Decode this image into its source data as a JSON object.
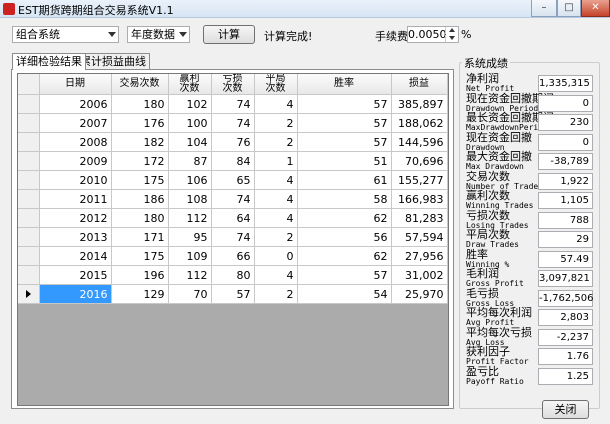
{
  "window": {
    "title": "EST期货跨期组合交易系统V1.1"
  },
  "controls": {
    "system_select": "组合系统",
    "period_select": "年度数据",
    "compute_button": "计算",
    "status": "计算完成!",
    "fee_label": "手续费",
    "fee_value": "0.0050",
    "fee_unit": "%"
  },
  "tabs": [
    {
      "label": "详细检验结果",
      "active": true
    },
    {
      "label": "累计损益曲线",
      "active": false
    }
  ],
  "table": {
    "headers": [
      "日期",
      "交易次数",
      "赢利\n次数",
      "亏损\n次数",
      "平局\n次数",
      "胜率",
      "损益"
    ],
    "rows": [
      [
        "2006",
        "180",
        "102",
        "74",
        "4",
        "57",
        "385,897"
      ],
      [
        "2007",
        "176",
        "100",
        "74",
        "2",
        "57",
        "188,062"
      ],
      [
        "2008",
        "182",
        "104",
        "76",
        "2",
        "57",
        "144,596"
      ],
      [
        "2009",
        "172",
        "87",
        "84",
        "1",
        "51",
        "70,696"
      ],
      [
        "2010",
        "175",
        "106",
        "65",
        "4",
        "61",
        "155,277"
      ],
      [
        "2011",
        "186",
        "108",
        "74",
        "4",
        "58",
        "166,983"
      ],
      [
        "2012",
        "180",
        "112",
        "64",
        "4",
        "62",
        "81,283"
      ],
      [
        "2013",
        "171",
        "95",
        "74",
        "2",
        "56",
        "57,594"
      ],
      [
        "2014",
        "175",
        "109",
        "66",
        "0",
        "62",
        "27,956"
      ],
      [
        "2015",
        "196",
        "112",
        "80",
        "4",
        "57",
        "31,002"
      ],
      [
        "2016",
        "129",
        "70",
        "57",
        "2",
        "54",
        "25,970"
      ]
    ],
    "current_row_index": 10
  },
  "stats": {
    "title": "系统成绩",
    "items": [
      {
        "zh": "净利润",
        "en": "Net Profit",
        "value": "1,335,315"
      },
      {
        "zh": "现在资金回撤期间",
        "en": "Drawdown Period",
        "value": "0"
      },
      {
        "zh": "最长资金回撤期间",
        "en": "MaxDrawdownPeriod",
        "value": "230"
      },
      {
        "zh": "现在资金回撤",
        "en": "Drawdown",
        "value": "0"
      },
      {
        "zh": "最大资金回撤",
        "en": "Max Drawdown",
        "value": "-38,789"
      },
      {
        "zh": "交易次数",
        "en": "Number of Trades",
        "value": "1,922"
      },
      {
        "zh": "赢利次数",
        "en": "Winning Trades",
        "value": "1,105"
      },
      {
        "zh": "亏损次数",
        "en": "Losing Trades",
        "value": "788"
      },
      {
        "zh": "平局次数",
        "en": "Draw Trades",
        "value": "29"
      },
      {
        "zh": "胜率",
        "en": "Winning %",
        "value": "57.49"
      },
      {
        "zh": "毛利润",
        "en": "Gross Profit",
        "value": "3,097,821"
      },
      {
        "zh": "毛亏损",
        "en": "Gross Loss",
        "value": "-1,762,506"
      },
      {
        "zh": "平均每次利润",
        "en": "Avg Profit",
        "value": "2,803"
      },
      {
        "zh": "平均每次亏损",
        "en": "Avg Loss",
        "value": "-2,237"
      },
      {
        "zh": "获利因子",
        "en": "Profit Factor",
        "value": "1.76"
      },
      {
        "zh": "盈亏比",
        "en": "Payoff Ratio",
        "value": "1.25"
      }
    ],
    "close_button": "关闭"
  }
}
